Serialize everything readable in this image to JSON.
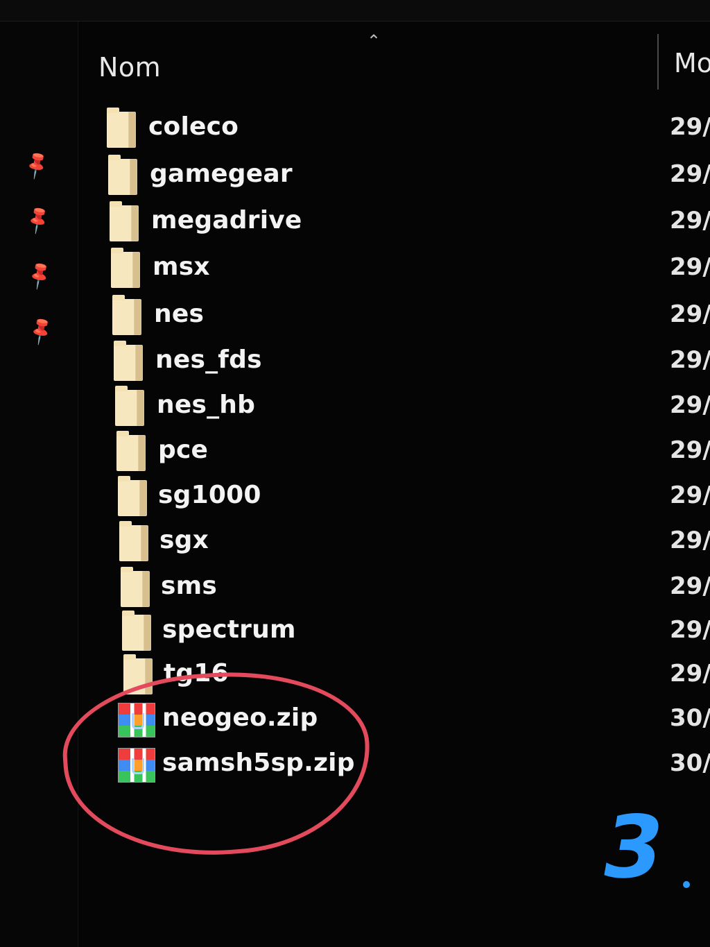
{
  "header": {
    "name_column": "Nom",
    "modified_column": "Mo"
  },
  "files": [
    {
      "name": "coleco",
      "date": "29/",
      "type": "folder"
    },
    {
      "name": "gamegear",
      "date": "29/",
      "type": "folder"
    },
    {
      "name": "megadrive",
      "date": "29/",
      "type": "folder"
    },
    {
      "name": "msx",
      "date": "29/",
      "type": "folder"
    },
    {
      "name": "nes",
      "date": "29/",
      "type": "folder"
    },
    {
      "name": "nes_fds",
      "date": "29/",
      "type": "folder"
    },
    {
      "name": "nes_hb",
      "date": "29/",
      "type": "folder"
    },
    {
      "name": "pce",
      "date": "29/",
      "type": "folder"
    },
    {
      "name": "sg1000",
      "date": "29/",
      "type": "folder"
    },
    {
      "name": "sgx",
      "date": "29/",
      "type": "folder"
    },
    {
      "name": "sms",
      "date": "29/",
      "type": "folder"
    },
    {
      "name": "spectrum",
      "date": "29/",
      "type": "folder"
    },
    {
      "name": "tg16",
      "date": "29/",
      "type": "folder"
    },
    {
      "name": "neogeo.zip",
      "date": "30/",
      "type": "zip"
    },
    {
      "name": "samsh5sp.zip",
      "date": "30/",
      "type": "zip"
    }
  ],
  "annotation": {
    "number": "3",
    "circle_color": "#e34b5d",
    "number_color": "#2c99ff"
  },
  "icons": {
    "sort": "chevron-up-icon",
    "pin": "pin-icon",
    "folder": "folder-icon",
    "zip": "archive-icon"
  }
}
